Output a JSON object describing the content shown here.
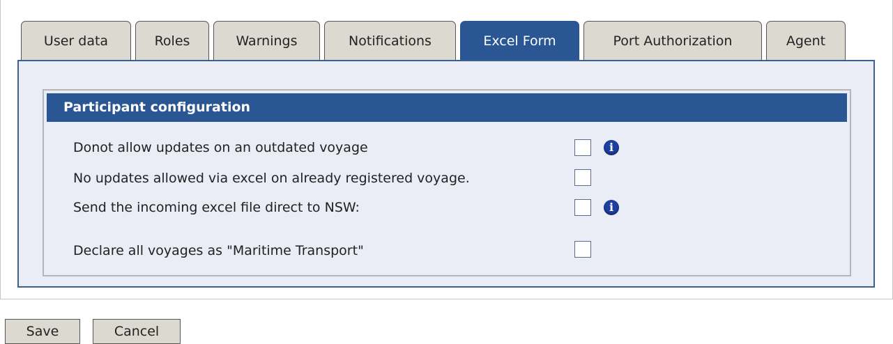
{
  "tabs": [
    {
      "label": "User data",
      "active": false
    },
    {
      "label": "Roles",
      "active": false
    },
    {
      "label": "Warnings",
      "active": false
    },
    {
      "label": "Notifications",
      "active": false
    },
    {
      "label": "Excel Form",
      "active": true
    },
    {
      "label": "Port Authorization",
      "active": false
    },
    {
      "label": "Agent",
      "active": false
    }
  ],
  "section": {
    "title": "Participant configuration",
    "options": [
      {
        "label": "Donot allow updates on an outdated voyage",
        "checked": false,
        "info_icon": true
      },
      {
        "label": "No updates allowed via excel on already registered voyage.",
        "checked": false,
        "info_icon": false
      },
      {
        "label": "Send the incoming excel file direct to NSW:",
        "checked": false,
        "info_icon": true
      },
      {
        "label": "Declare all voyages as \"Maritime Transport\"",
        "checked": false,
        "info_icon": false
      }
    ]
  },
  "buttons": {
    "save": "Save",
    "cancel": "Cancel"
  },
  "icons": {
    "info": "info-icon"
  },
  "colors": {
    "accent": "#2a5793",
    "tab_inactive": "#dcd9d1",
    "panel_bg": "#eaecf6",
    "info": "#1d3f9e"
  }
}
